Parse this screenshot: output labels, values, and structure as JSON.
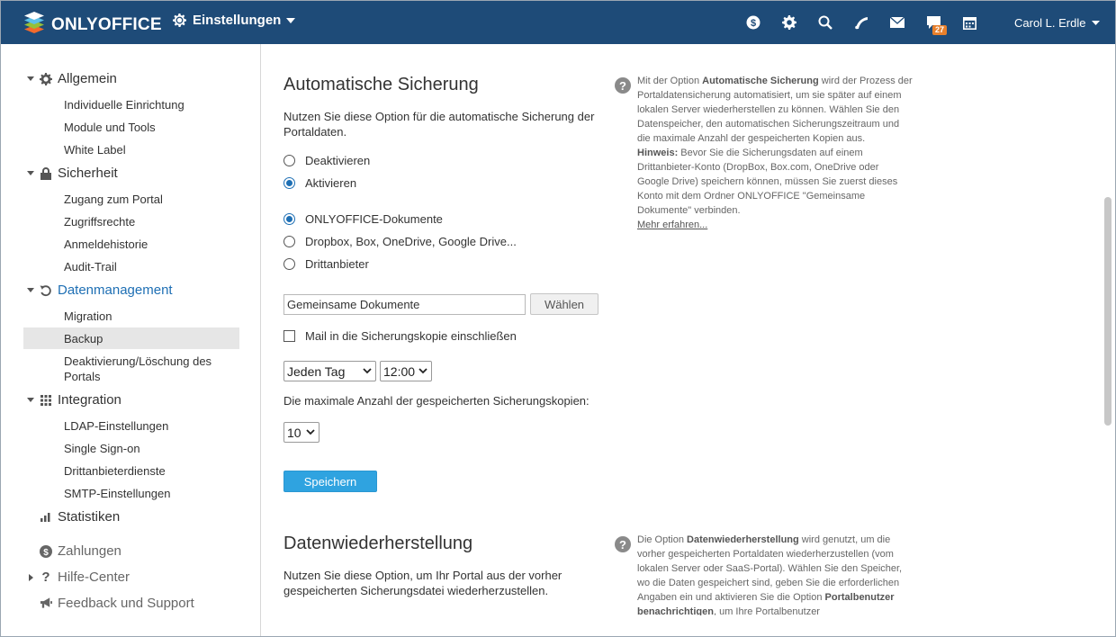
{
  "header": {
    "logo_text": "ONLYOFFICE",
    "module_label": "Einstellungen",
    "chat_badge": "27",
    "user_name": "Carol L. Erdle",
    "icons": [
      "payments-icon",
      "settings-icon",
      "search-icon",
      "feed-icon",
      "mail-icon",
      "chat-icon",
      "calendar-icon"
    ],
    "bg_color": "#1e4b78"
  },
  "sidebar": {
    "groups": [
      {
        "label": "Allgemein",
        "icon": "gear-icon",
        "items": [
          "Individuelle Einrichtung",
          "Module und Tools",
          "White Label"
        ]
      },
      {
        "label": "Sicherheit",
        "icon": "lock-icon",
        "items": [
          "Zugang zum Portal",
          "Zugriffsrechte",
          "Anmeldehistorie",
          "Audit-Trail"
        ]
      },
      {
        "label": "Datenmanagement",
        "icon": "restore-icon",
        "items": [
          "Migration",
          "Backup",
          "Deaktivierung/Löschung des Portals"
        ]
      },
      {
        "label": "Integration",
        "icon": "grid-icon",
        "items": [
          "LDAP-Einstellungen",
          "Single Sign-on",
          "Drittanbieterdienste",
          "SMTP-Einstellungen"
        ]
      },
      {
        "label": "Statistiken",
        "icon": "stats-icon"
      },
      {
        "label": "Zahlungen",
        "icon": "dollar-icon"
      },
      {
        "label": "Hilfe-Center",
        "icon": "question-icon"
      },
      {
        "label": "Feedback und Support",
        "icon": "megaphone-icon"
      }
    ],
    "selected_item": "Backup",
    "active_color": "#1e6fb4"
  },
  "backup": {
    "title": "Automatische Sicherung",
    "description": "Nutzen Sie diese Option für die automatische Sicherung der Portaldaten.",
    "mode_options": [
      "Deaktivieren",
      "Aktivieren"
    ],
    "mode_selected": "Aktivieren",
    "storage_options": [
      "ONLYOFFICE-Dokumente",
      "Dropbox, Box, OneDrive, Google Drive...",
      "Drittanbieter"
    ],
    "storage_selected": "ONLYOFFICE-Dokumente",
    "folder_value": "Gemeinsame Dokumente",
    "choose_label": "Wählen",
    "include_mail_label": "Mail in die Sicherungskopie einschließen",
    "include_mail_checked": false,
    "period_value": "Jeden Tag",
    "time_value": "12:00",
    "max_copies_label": "Die maximale Anzahl der gespeicherten Sicherungskopien:",
    "max_copies_value": "10",
    "save_label": "Speichern",
    "help": {
      "p1_before": "Mit der Option ",
      "p1_bold": "Automatische Sicherung",
      "p1_after": " wird der Prozess der Portaldatensicherung automatisiert, um sie später auf einem lokalen Server wiederherstellen zu können. Wählen Sie den Datenspeicher, den automatischen Sicherungszeitraum und die maximale Anzahl der gespeicherten Kopien aus.",
      "p2_bold": "Hinweis:",
      "p2_after": " Bevor Sie die Sicherungsdaten auf einem Drittanbieter-Konto (DropBox, Box.com, OneDrive oder Google Drive) speichern können, müssen Sie zuerst dieses Konto mit dem Ordner ONLYOFFICE \"Gemeinsame Dokumente\" verbinden.",
      "link": "Mehr erfahren..."
    }
  },
  "restore": {
    "title": "Datenwiederherstellung",
    "description": "Nutzen Sie diese Option, um Ihr Portal aus der vorher gespeicherten Sicherungsdatei wiederherzustellen.",
    "help": {
      "p1_before": "Die Option ",
      "p1_bold": "Datenwiederherstellung",
      "p1_after": " wird genutzt, um die vorher gespeicherten Portaldaten wiederherzustellen (vom lokalen Server oder SaaS-Portal). Wählen Sie den Speicher, wo die Daten gespeichert sind, geben Sie die erforderlichen Angaben ein und aktivieren Sie die Option ",
      "p1_bold2": "Portalbenutzer benachrichtigen",
      "p1_tail": ", um Ihre Portalbenutzer"
    }
  },
  "accent": {
    "primary_button": "#2fa3e0",
    "link_blue": "#1e6fb4"
  }
}
